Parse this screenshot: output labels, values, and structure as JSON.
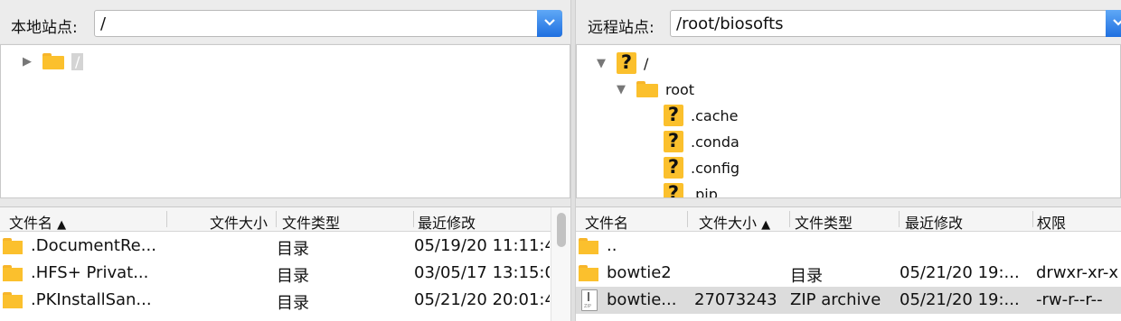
{
  "local": {
    "site_label": "本地站点:",
    "path": "/",
    "tree": [
      {
        "label": "/",
        "expanded": false,
        "icon": "folder-icon"
      }
    ],
    "columns": [
      "文件名",
      "文件大小",
      "文件类型",
      "最近修改"
    ],
    "sort_column": "文件名",
    "rows": [
      {
        "name": ".DocumentRe...",
        "size": "",
        "type": "目录",
        "modified": "05/19/20 11:11:4",
        "icon": "folder-icon"
      },
      {
        "name": ".HFS+ Privat...",
        "size": "",
        "type": "目录",
        "modified": "03/05/17 13:15:0",
        "icon": "folder-icon"
      },
      {
        "name": ".PKInstallSan...",
        "size": "",
        "type": "目录",
        "modified": "05/21/20 20:01:4",
        "icon": "folder-icon"
      }
    ]
  },
  "remote": {
    "site_label": "远程站点:",
    "path": "/root/biosofts",
    "tree": [
      {
        "label": "/",
        "expanded": true,
        "icon": "question-icon"
      },
      {
        "label": "root",
        "expanded": true,
        "icon": "folder-icon"
      },
      {
        "label": ".cache",
        "icon": "question-icon"
      },
      {
        "label": ".conda",
        "icon": "question-icon"
      },
      {
        "label": ".config",
        "icon": "question-icon"
      },
      {
        "label": ".pip",
        "icon": "question-icon"
      }
    ],
    "columns": [
      "文件名",
      "文件大小",
      "文件类型",
      "最近修改",
      "权限"
    ],
    "sort_column": "文件大小",
    "rows": [
      {
        "name": "..",
        "size": "",
        "type": "",
        "modified": "",
        "perms": "",
        "icon": "folder-icon"
      },
      {
        "name": "bowtie2",
        "size": "",
        "type": "目录",
        "modified": "05/21/20 19:...",
        "perms": "drwxr-xr-x",
        "icon": "folder-icon"
      },
      {
        "name": "bowtie...",
        "size": "27073243",
        "type": "ZIP archive",
        "modified": "05/21/20 19:...",
        "perms": "-rw-r--r--",
        "icon": "zip-file-icon",
        "selected": true
      }
    ]
  },
  "colors": {
    "accent": "#1f6fe0",
    "folder": "#fbc02d",
    "selection": "#dcdcdc"
  }
}
